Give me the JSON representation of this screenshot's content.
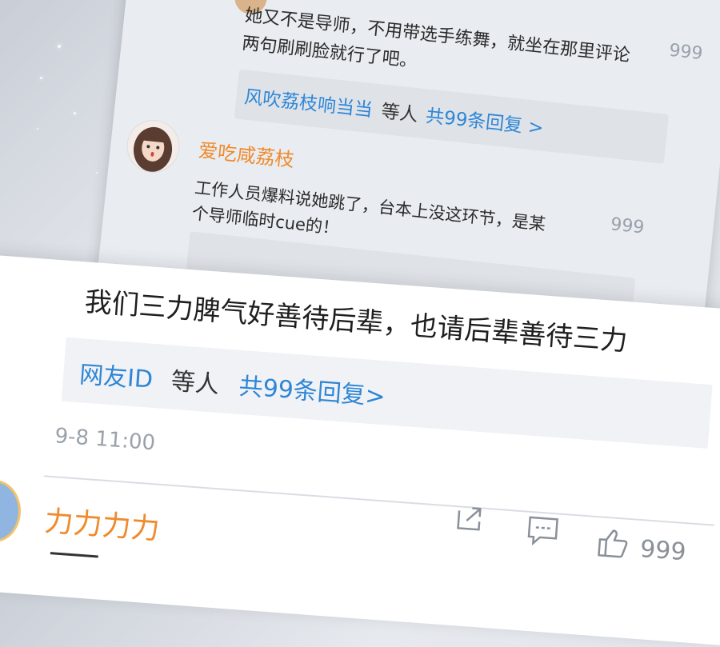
{
  "back_card": {
    "comment_line1": "她又不是导师，不用带选手练舞，就坐在那里评论",
    "comment_line2": "两句刷刷脸就行了吧。",
    "comment_count": "999",
    "reply_user": "风吹荔枝响当当",
    "reply_mid": "等人",
    "reply_total": "共99条回复 >",
    "user2_name": "爱吃咸荔枝",
    "user2_line1": "工作人员爆料说她跳了，台本上没这环节，是某",
    "user2_line2": "个导师临时cue的！",
    "user2_count": "999"
  },
  "front_card": {
    "comment": "我们三力脾气好善待后辈，也请后辈善待三力",
    "reply_user": "网友ID",
    "reply_mid": "等人",
    "reply_total": "共99条回复>",
    "timestamp": "9-8 11:00",
    "next_user": "力力力力",
    "like_count": "999"
  },
  "icons": {
    "share": "share-icon",
    "comment": "comment-icon",
    "like": "thumbs-up-icon"
  },
  "colors": {
    "link_blue": "#2f86d6",
    "username_orange": "#f08a2c"
  }
}
